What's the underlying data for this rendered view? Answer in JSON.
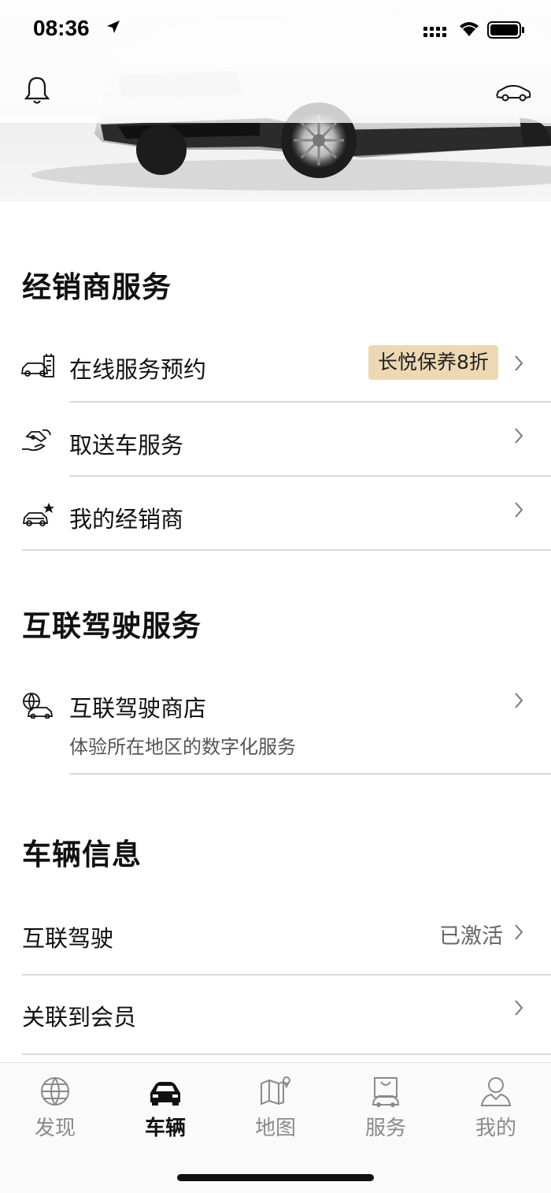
{
  "status_bar": {
    "time": "08:36"
  },
  "dealer_services": {
    "title": "经销商服务",
    "items": [
      {
        "label": "在线服务预约",
        "badge": "长悦保养8折",
        "icon": "service-booking-icon"
      },
      {
        "label": "取送车服务",
        "icon": "pickup-delivery-icon"
      },
      {
        "label": "我的经销商",
        "icon": "my-dealer-icon"
      }
    ]
  },
  "connected_services": {
    "title": "互联驾驶服务",
    "items": [
      {
        "label": "互联驾驶商店",
        "subtitle": "体验所在地区的数字化服务",
        "icon": "connected-store-icon"
      }
    ]
  },
  "vehicle_info": {
    "title": "车辆信息",
    "items": [
      {
        "label": "互联驾驶",
        "value": "已激活"
      },
      {
        "label": "关联到会员"
      }
    ]
  },
  "bottom_nav": {
    "items": [
      {
        "label": "发现",
        "icon": "globe-icon",
        "active": false
      },
      {
        "label": "车辆",
        "icon": "car-icon",
        "active": true
      },
      {
        "label": "地图",
        "icon": "map-icon",
        "active": false
      },
      {
        "label": "服务",
        "icon": "service-bag-icon",
        "active": false
      },
      {
        "label": "我的",
        "icon": "profile-icon",
        "active": false
      }
    ]
  },
  "colors": {
    "badge_bg": "#ecd9b3",
    "active_nav": "#111111",
    "inactive_nav": "#8a8a8a"
  }
}
